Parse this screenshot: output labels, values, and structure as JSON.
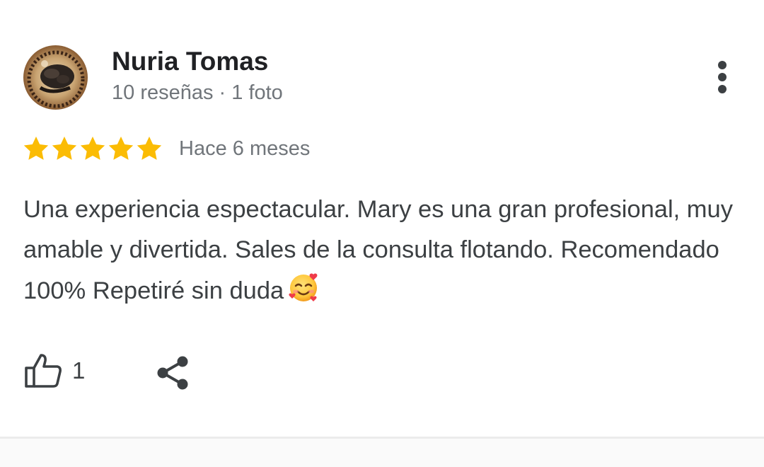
{
  "review": {
    "author": {
      "name": "Nuria Tomas",
      "meta": "10 reseñas · 1 foto",
      "avatar": "profile-photo"
    },
    "rating": {
      "stars": 5,
      "max": 5,
      "color": "#fbbc04"
    },
    "time_ago": "Hace 6 meses",
    "text": "Una experiencia espectacular. Mary es una gran profesional, muy amable y divertida. Sales de la consulta flotando. Recomendado 100% Repetiré sin duda",
    "emoji": "smiling-face-with-hearts",
    "actions": {
      "like_icon": "thumbs-up-icon",
      "like_count": "1",
      "share_icon": "share-icon",
      "more_icon": "more-vert-icon"
    }
  },
  "colors": {
    "name": "#202124",
    "secondary": "#70757a",
    "body": "#3c4043",
    "divider": "#ececec"
  }
}
